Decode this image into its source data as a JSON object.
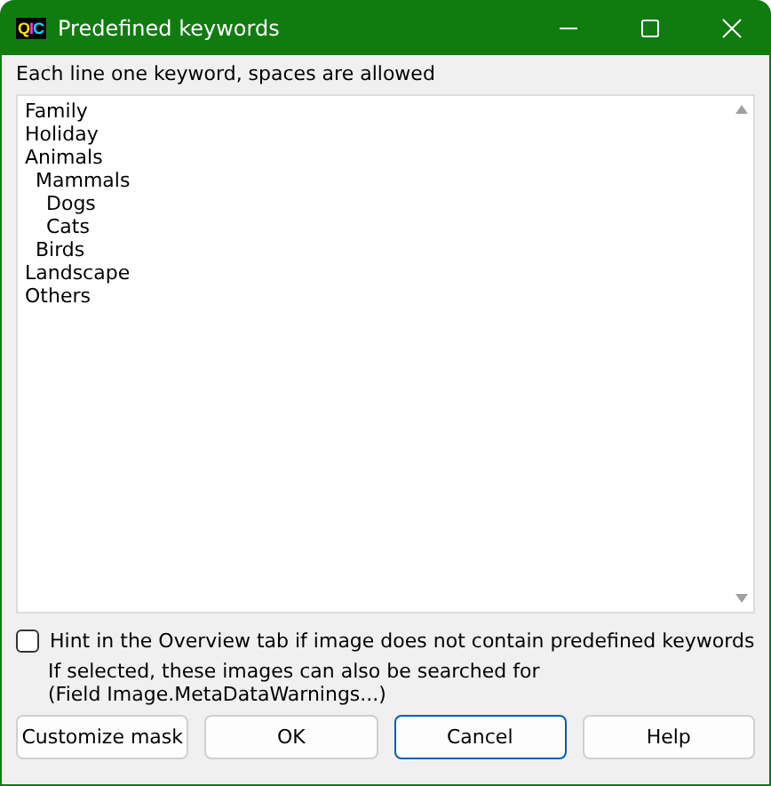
{
  "window": {
    "icon_text": "QIC",
    "title": "Predefined keywords"
  },
  "instruction": "Each line one keyword, spaces are allowed",
  "keywords": [
    {
      "text": "Family"
    },
    {
      "text": "Holiday"
    },
    {
      "text": "Animals",
      "children": [
        {
          "text": "Mammals",
          "children": [
            {
              "text": "Dogs"
            },
            {
              "text": "Cats"
            }
          ]
        },
        {
          "text": "Birds"
        }
      ]
    },
    {
      "text": "Landscape"
    },
    {
      "text": "Others"
    }
  ],
  "hint_option": {
    "label": "Hint in the Overview tab if image does not contain predefined keywords",
    "checked": false
  },
  "hint_description": [
    "If selected, these images can also be searched for",
    "(Field Image.MetaDataWarnings...)"
  ],
  "buttons": [
    {
      "label": "Customize mask",
      "focused": false
    },
    {
      "label": "OK",
      "focused": false
    },
    {
      "label": "Cancel",
      "focused": true
    },
    {
      "label": "Help",
      "focused": false
    }
  ]
}
